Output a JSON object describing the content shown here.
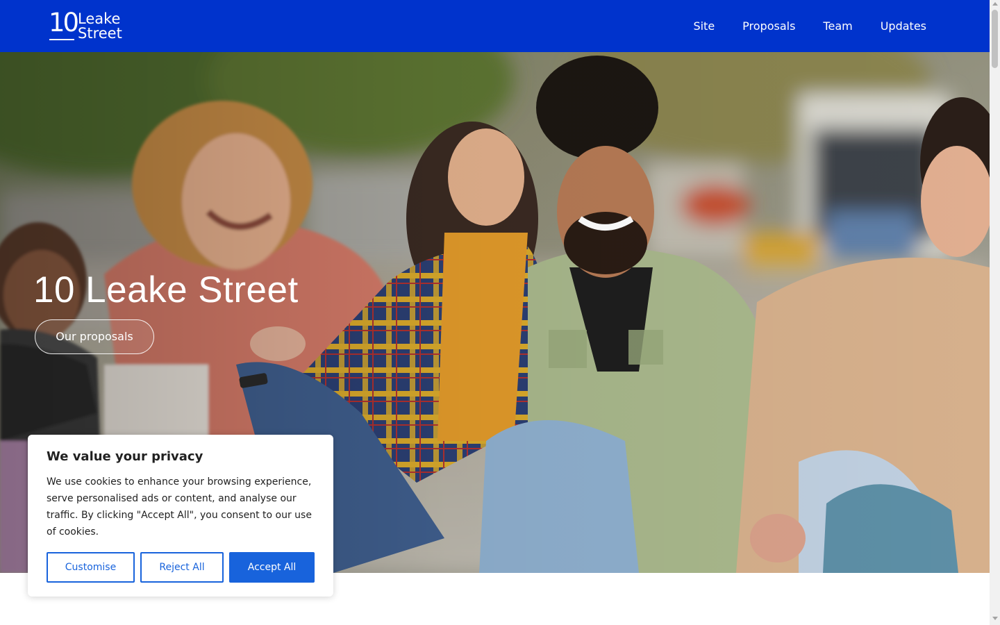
{
  "header": {
    "logo": {
      "number": "10",
      "line1": "Leake",
      "line2": "Street"
    },
    "nav": [
      "Site",
      "Proposals",
      "Team",
      "Updates"
    ]
  },
  "hero": {
    "title": "10 Leake Street",
    "button_label": "Our proposals",
    "image_description_icon": "photo-icon"
  },
  "cookie_banner": {
    "title": "We value your privacy",
    "text": "We use cookies to enhance your browsing experience, serve personalised ads or content, and analyse our traffic. By clicking \"Accept All\", you consent to our use of cookies.",
    "buttons": {
      "customise": "Customise",
      "reject": "Reject All",
      "accept": "Accept All"
    }
  },
  "colors": {
    "header_bg": "#0033cc",
    "cookie_accent": "#1863dc"
  }
}
